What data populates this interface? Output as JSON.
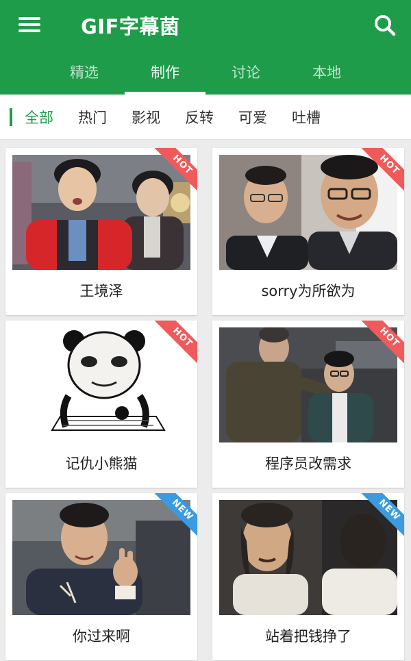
{
  "app": {
    "title": "GIF字幕菌"
  },
  "tabs": [
    {
      "label": "精选"
    },
    {
      "label": "制作"
    },
    {
      "label": "讨论"
    },
    {
      "label": "本地"
    }
  ],
  "active_tab": "制作",
  "filters": [
    {
      "label": "全部"
    },
    {
      "label": "热门"
    },
    {
      "label": "影视"
    },
    {
      "label": "反转"
    },
    {
      "label": "可爱"
    },
    {
      "label": "吐槽"
    }
  ],
  "active_filter": "全部",
  "cards": [
    {
      "caption": "王境泽",
      "badge": "HOT"
    },
    {
      "caption": "sorry为所欲为",
      "badge": "HOT"
    },
    {
      "caption": "记仇小熊猫",
      "badge": "HOT"
    },
    {
      "caption": "程序员改需求",
      "badge": "HOT"
    },
    {
      "caption": "你过来啊",
      "badge": "NEW"
    },
    {
      "caption": "站着把钱挣了",
      "badge": "NEW"
    }
  ],
  "icons": {
    "menu": "hamburger-menu-icon",
    "search": "search-icon"
  },
  "colors": {
    "primary": "#1f9c4a",
    "hot": "#f05a5a",
    "new": "#3a9be0"
  }
}
